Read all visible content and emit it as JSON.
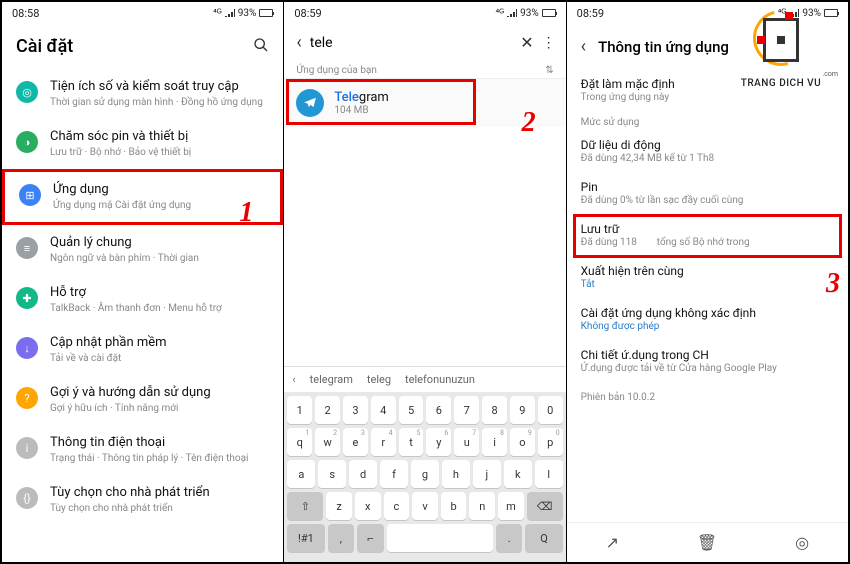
{
  "status": {
    "time1": "08:58",
    "time2": "08:59",
    "time3": "08:59",
    "net": "⁴ᴳ",
    "batt": "93%"
  },
  "screen1": {
    "title": "Cài đặt",
    "items": [
      {
        "icon": "◎",
        "cls": "ic-teal",
        "title": "Tiện ích số và kiểm soát truy cập",
        "sub": "Thời gian sử dụng màn hình · Đồng hồ ứng dụng"
      },
      {
        "icon": "◑",
        "cls": "ic-green",
        "title": "Chăm sóc pin và thiết bị",
        "sub": "Lưu trữ · Bộ nhớ · Bảo vệ thiết bị"
      },
      {
        "icon": "⊞",
        "cls": "ic-blue",
        "title": "Ứng dụng",
        "sub": "Ứng dụng mặ         Cài đặt ứng dụng"
      },
      {
        "icon": "≡",
        "cls": "ic-grey",
        "title": "Quản lý chung",
        "sub": "Ngôn ngữ và bàn phím · Thời gian"
      },
      {
        "icon": "✚",
        "cls": "ic-teal2",
        "title": "Hỗ trợ",
        "sub": "TalkBack · Âm thanh đơn · Menu hỗ trợ"
      },
      {
        "icon": "↓",
        "cls": "ic-purple",
        "title": "Cập nhật phần mềm",
        "sub": "Tải về và cài đặt"
      },
      {
        "icon": "?",
        "cls": "ic-orange",
        "title": "Gợi ý và hướng dẫn sử dụng",
        "sub": "Gợi ý hữu ích · Tính năng mới"
      },
      {
        "icon": "i",
        "cls": "ic-grey2",
        "title": "Thông tin điện thoại",
        "sub": "Trạng thái · Thông tin pháp lý · Tên điện thoại"
      },
      {
        "icon": "{}",
        "cls": "ic-grey2",
        "title": "Tùy chọn cho nhà phát triển",
        "sub": "Tùy chọn cho nhà phát triển"
      }
    ],
    "marker": "1"
  },
  "screen2": {
    "query": "tele",
    "section": "Ứng dụng của bạn",
    "app": {
      "prefix": "Tele",
      "rest": "gram",
      "size": "104 MB"
    },
    "marker": "2",
    "suggestions": [
      "telegram",
      "teleg",
      "telefonunuzun"
    ],
    "rows": [
      [
        "1",
        "2",
        "3",
        "4",
        "5",
        "6",
        "7",
        "8",
        "9",
        "0"
      ],
      [
        "q",
        "w",
        "e",
        "r",
        "t",
        "y",
        "u",
        "i",
        "o",
        "p"
      ],
      [
        "a",
        "s",
        "d",
        "f",
        "g",
        "h",
        "j",
        "k",
        "l"
      ],
      [
        "z",
        "x",
        "c",
        "v",
        "b",
        "n",
        "m"
      ]
    ]
  },
  "screen3": {
    "title": "Thông tin ứng dụng",
    "marker": "3",
    "logo": {
      "text": "TRANG DICH VU",
      "com": ".com"
    },
    "default": {
      "t": "Đặt làm mặc định",
      "s": "Trong ứng dụng này"
    },
    "sec_usage": "Mức sử dụng",
    "data": {
      "t": "Dữ liệu di động",
      "s": "Đã dùng 42,34 MB kể từ 1 Th8"
    },
    "pin": {
      "t": "Pin",
      "s": "Đã dùng 0% từ lần sạc đầy cuối cùng"
    },
    "storage": {
      "t": "Lưu trữ",
      "s1": "Đã dùng 118",
      "s2": "tổng số Bộ nhớ trong"
    },
    "ontop": {
      "t": "Xuất hiện trên cùng",
      "s": "Tắt"
    },
    "unknown": {
      "t": "Cài đặt ứng dụng không xác định",
      "s": "Không được phép"
    },
    "store": {
      "t": "Chi tiết ứ.dụng trong CH",
      "s": "Ứ.dụng được tải về từ Cửa hàng Google Play"
    },
    "version": "Phiên bản 10.0.2"
  }
}
